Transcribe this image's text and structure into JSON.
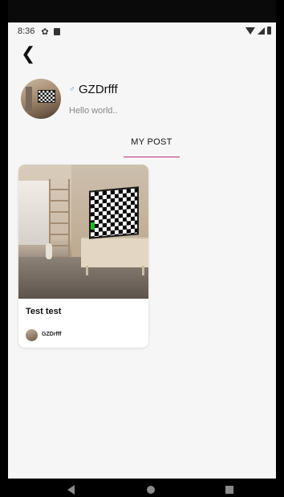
{
  "status_bar": {
    "time": "8:36"
  },
  "profile": {
    "gender_symbol": "♂",
    "username": "GZDrfff",
    "bio": "Hello world.."
  },
  "tabs": {
    "active": "MY POST"
  },
  "posts": [
    {
      "title": "Test test",
      "author": "GZDrfff"
    }
  ],
  "colors": {
    "tab_indicator": "#c22b79",
    "gender_icon": "#3d8fe6",
    "background": "#f6f6f6"
  },
  "icons": {
    "back": "back-arrow-icon",
    "nav_back": "nav-back-icon",
    "nav_home": "nav-home-icon",
    "nav_recent": "nav-recents-icon"
  }
}
